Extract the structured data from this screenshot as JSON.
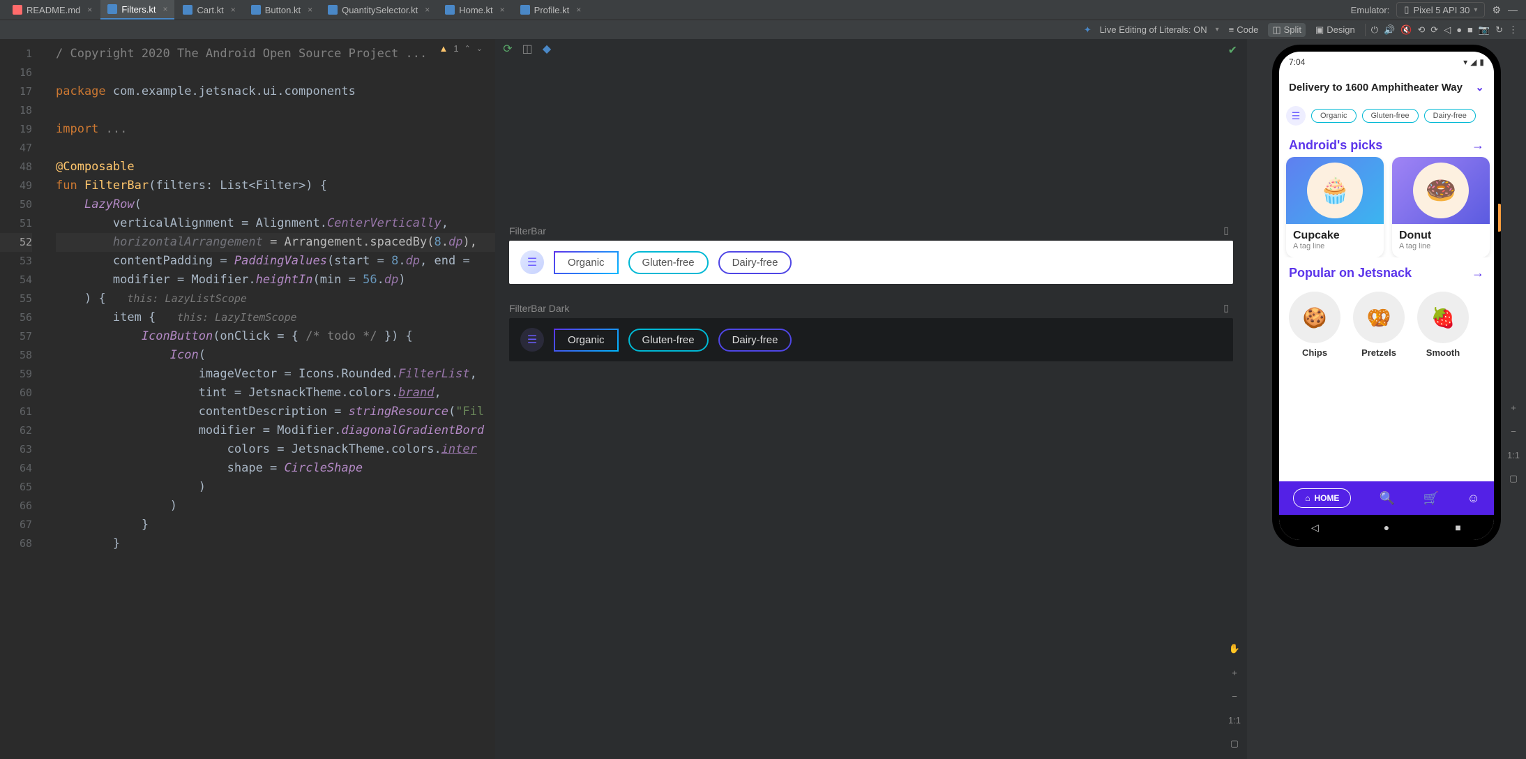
{
  "tabs": [
    {
      "label": "README.md",
      "type": "md"
    },
    {
      "label": "Filters.kt",
      "type": "kt",
      "active": true
    },
    {
      "label": "Cart.kt",
      "type": "kt"
    },
    {
      "label": "Button.kt",
      "type": "kt"
    },
    {
      "label": "QuantitySelector.kt",
      "type": "kt"
    },
    {
      "label": "Home.kt",
      "type": "kt"
    },
    {
      "label": "Profile.kt",
      "type": "kt"
    }
  ],
  "emulator_label": "Emulator:",
  "device": "Pixel 5 API 30",
  "toolbar": {
    "live_edit": "Live Editing of Literals: ON",
    "code": "Code",
    "split": "Split",
    "design": "Design"
  },
  "gutter_lines": [
    "1",
    "16",
    "17",
    "18",
    "19",
    "47",
    "48",
    "49",
    "50",
    "51",
    "52",
    "53",
    "54",
    "55",
    "56",
    "57",
    "58",
    "59",
    "60",
    "61",
    "62",
    "63",
    "64",
    "65",
    "66",
    "67",
    "68"
  ],
  "highlight_line_index": 10,
  "inspections": {
    "count": "1"
  },
  "code": {
    "l0_a": "/ Copyright 2020 The Android Open Source Project ...",
    "l2_kw": "package ",
    "l2_b": "com.example.jetsnack.ui.components",
    "l4_kw": "import ",
    "l4_b": "...",
    "l6": "@Composable",
    "l7_kw": "fun ",
    "l7_fn": "FilterBar",
    "l7_b": "(filters: List<Filter>) {",
    "l8_a": "    ",
    "l8_i": "LazyRow",
    "l8_b": "(",
    "l9_a": "        verticalAlignment = Alignment.",
    "l9_i": "CenterVertically",
    "l9_b": ",",
    "l10": "        horizontalArrangement = Arrangement.spacedBy(8.dp),",
    "l10_a": "        ",
    "l10_p": "horizontalArrangement",
    "l10_b": " = Arrangement.spacedBy(",
    "l10_lit": "8",
    "l10_c": ".",
    "l10_i": "dp",
    "l10_d": "),",
    "l11_a": "        contentPadding = ",
    "l11_i": "PaddingValues",
    "l11_b": "(start = ",
    "l11_lit": "8",
    "l11_c": ".",
    "l11_i2": "dp",
    "l11_d": ", end = ",
    "l12_a": "        modifier = Modifier.",
    "l12_i": "heightIn",
    "l12_b": "(min = ",
    "l12_lit": "56",
    "l12_c": ".",
    "l12_i2": "dp",
    "l12_d": ")",
    "l13_a": "    ) {   ",
    "l13_h": "this: LazyListScope",
    "l14_a": "        item {   ",
    "l14_h": "this: LazyItemScope",
    "l15_a": "            ",
    "l15_i": "IconButton",
    "l15_b": "(onClick = { ",
    "l15_c": "/* todo */",
    "l15_d": " }) {",
    "l16_a": "                ",
    "l16_i": "Icon",
    "l16_b": "(",
    "l17_a": "                    imageVector = Icons.Rounded.",
    "l17_i": "FilterList",
    "l17_b": ",",
    "l18_a": "                    tint = JetsnackTheme.colors.",
    "l18_p": "brand",
    "l18_b": ",",
    "l19_a": "                    contentDescription = ",
    "l19_i": "stringResource",
    "l19_b": "(",
    "l19_s": "\"Fil",
    "l20_a": "                    modifier = Modifier.",
    "l20_i": "diagonalGradientBord",
    "l21_a": "                        colors = JetsnackTheme.colors.",
    "l21_p": "inter",
    "l22_a": "                        shape = ",
    "l22_i": "CircleShape",
    "l23": "                    )",
    "l24": "                )",
    "l25": "            }",
    "l26": "        }"
  },
  "preview": {
    "light": "FilterBar",
    "dark": "FilterBar Dark",
    "chips": [
      "Organic",
      "Gluten-free",
      "Dairy-free"
    ]
  },
  "pv_ratio": "1:1",
  "phone": {
    "time": "7:04",
    "delivery": "Delivery to 1600 Amphitheater Way",
    "chips": [
      "Organic",
      "Gluten-free",
      "Dairy-free"
    ],
    "section1": "Android's picks",
    "cards": [
      {
        "t": "Cupcake",
        "s": "A tag line"
      },
      {
        "t": "Donut",
        "s": "A tag line"
      }
    ],
    "section2": "Popular on Jetsnack",
    "rounds": [
      "Chips",
      "Pretzels",
      "Smooth"
    ],
    "home": "HOME"
  }
}
